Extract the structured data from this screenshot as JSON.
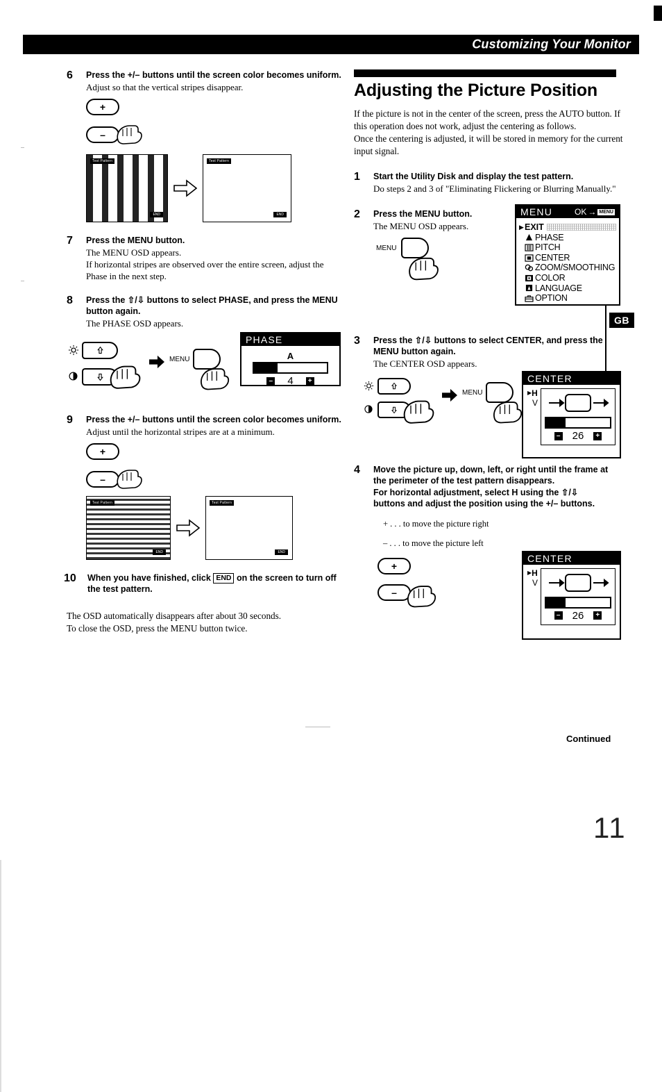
{
  "header": {
    "title": "Customizing Your Monitor",
    "side_tab": "GB"
  },
  "page_number": "11",
  "footer": {
    "continued": "Continued"
  },
  "left_column": {
    "steps": [
      {
        "num": "6",
        "title": "Press the +/– buttons until the screen color becomes uniform.",
        "desc": "Adjust so that the vertical stripes disappear."
      },
      {
        "num": "7",
        "title": "Press the MENU button.",
        "desc": "The MENU OSD appears.",
        "desc2": "If horizontal stripes are observed over the entire screen, adjust the Phase in the next step."
      },
      {
        "num": "8",
        "title": "Press the ⇧/⇩ buttons to select PHASE, and press the MENU button again.",
        "desc": "The PHASE OSD appears."
      },
      {
        "num": "9",
        "title": "Press the +/– buttons until the screen color becomes uniform.",
        "desc": "Adjust until the horizontal stripes are at a minimum."
      },
      {
        "num": "10",
        "title_pre": "When you have finished, click",
        "title_box": "END",
        "title_post": "on the screen to turn off the test pattern."
      }
    ],
    "closing": {
      "line1": "The OSD automatically disappears after about 30 seconds.",
      "line2": "To close the OSD, press the MENU button twice."
    },
    "keys": {
      "plus": "+",
      "minus": "–",
      "up": "✧",
      "down": "✧",
      "menu": "MENU"
    },
    "phase_osd": {
      "title": "PHASE",
      "icon": "A",
      "value": "4",
      "minus": "–",
      "plus": "+",
      "fill_percent": 32
    },
    "test_pattern": {
      "label": "Test Pattern",
      "end": "END"
    }
  },
  "right_column": {
    "section_title": "Adjusting the Picture Position",
    "intro": {
      "p1": "If the picture is not in the center of the screen, press the AUTO button.  If this operation does not work, adjust the centering as follows.",
      "p2": "Once the centering is adjusted, it will be stored in memory for the current input signal."
    },
    "steps": [
      {
        "num": "1",
        "title": "Start the Utility Disk and display the test pattern.",
        "desc": "Do steps 2 and 3 of \"Eliminating Flickering or Blurring Manually.\""
      },
      {
        "num": "2",
        "title": "Press the MENU button.",
        "desc": "The MENU OSD appears."
      },
      {
        "num": "3",
        "title": "Press the ⇧/⇩ buttons to select CENTER, and press the MENU button again.",
        "desc": "The CENTER OSD appears."
      },
      {
        "num": "4",
        "title": "Move the picture up, down, left, or right until the frame at the perimeter of the test pattern disappears.",
        "title2": "For horizontal adjustment, select H using the ⇧/⇩ buttons and adjust the position using the +/– buttons.",
        "note1": "+ . . . to move the picture right",
        "note2": "– . . . to move the picture left"
      }
    ],
    "menu_osd": {
      "title": "MENU",
      "ok_label": "OK",
      "ok_arrow": "→",
      "ok_badge": "MENU",
      "caret": "▶",
      "items": [
        {
          "label": "EXIT",
          "icon": "exit-icon",
          "selected": true
        },
        {
          "label": "PHASE",
          "icon": "phase-icon",
          "selected": false
        },
        {
          "label": "PITCH",
          "icon": "pitch-icon",
          "selected": false
        },
        {
          "label": "CENTER",
          "icon": "center-icon",
          "selected": false
        },
        {
          "label": "ZOOM/SMOOTHING",
          "icon": "zoom-icon",
          "selected": false
        },
        {
          "label": "COLOR",
          "icon": "color-icon",
          "selected": false
        },
        {
          "label": "LANGUAGE",
          "icon": "language-icon",
          "selected": false
        },
        {
          "label": "OPTION",
          "icon": "option-icon",
          "selected": false
        }
      ]
    },
    "center_osd": {
      "title": "CENTER",
      "caret": "▶",
      "axis_h": "H",
      "axis_v": "V",
      "value": "26",
      "minus": "–",
      "plus": "+",
      "fill_percent": 30
    },
    "keys": {
      "menu": "MENU",
      "plus": "+",
      "minus": "–"
    }
  }
}
